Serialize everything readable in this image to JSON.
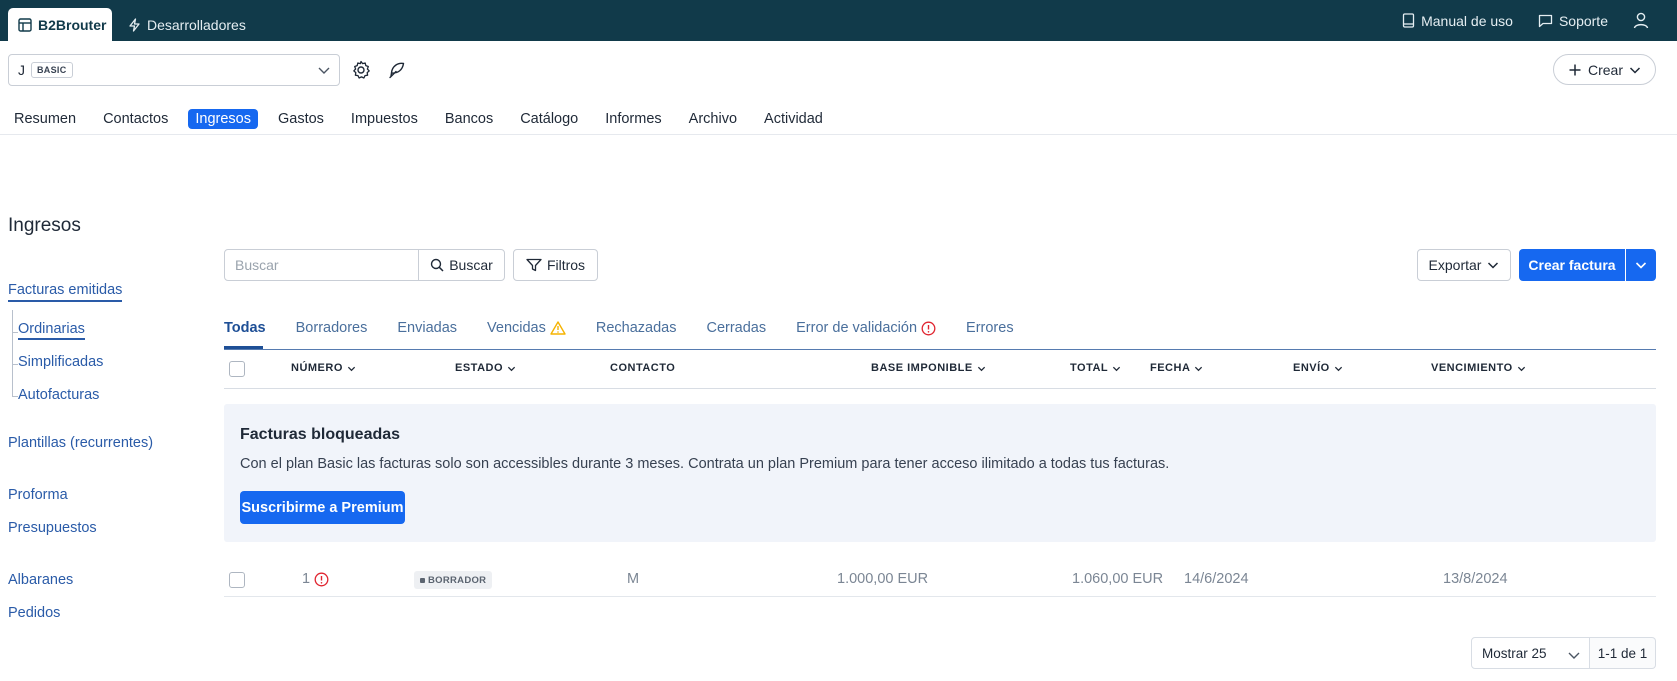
{
  "topbar": {
    "app_tab": "B2Brouter",
    "dev_tab": "Desarrolladores",
    "manual": "Manual de uso",
    "support": "Soporte",
    "icons": {
      "app": "table-icon",
      "dev": "bolt-icon",
      "manual": "book-icon",
      "support": "chat-icon",
      "user": "user-icon"
    }
  },
  "company": {
    "initial": "J",
    "plan": "BASIC",
    "create_label": "Crear"
  },
  "nav": {
    "items": [
      "Resumen",
      "Contactos",
      "Ingresos",
      "Gastos",
      "Impuestos",
      "Bancos",
      "Catálogo",
      "Informes",
      "Archivo",
      "Actividad"
    ],
    "active": "Ingresos"
  },
  "sidebar": {
    "title": "Ingresos",
    "issued": "Facturas emitidas",
    "sub": [
      "Ordinarias",
      "Simplificadas",
      "Autofacturas"
    ],
    "templates": "Plantillas (recurrentes)",
    "proforma": "Proforma",
    "quotes": "Presupuestos",
    "delivery": "Albaranes",
    "orders": "Pedidos"
  },
  "toolbar": {
    "search_placeholder": "Buscar",
    "search_label": "Buscar",
    "filter_label": "Filtros",
    "export_label": "Exportar",
    "create_label": "Crear factura"
  },
  "status_tabs": [
    "Todas",
    "Borradores",
    "Enviadas",
    "Vencidas",
    "Rechazadas",
    "Cerradas",
    "Error de validación",
    "Errores"
  ],
  "table": {
    "headers": {
      "number": "NÚMERO",
      "status": "ESTADO",
      "contact": "CONTACTO",
      "base": "BASE IMPONIBLE",
      "total": "TOTAL",
      "date": "FECHA",
      "send": "ENVÍO",
      "due": "VENCIMIENTO"
    },
    "rows": [
      {
        "number": "1",
        "status": "BORRADOR",
        "contact": "M",
        "base": "1.000,00 EUR",
        "total": "1.060,00 EUR",
        "date": "14/6/2024",
        "send": "",
        "due": "13/8/2024"
      }
    ]
  },
  "banner": {
    "title": "Facturas bloqueadas",
    "text": "Con el plan Basic las facturas solo son accessibles durante 3 meses. Contrata un plan Premium para tener acceso ilimitado a todas tus facturas.",
    "button": "Suscribirme a Premium"
  },
  "pagination": {
    "page_size": "Mostrar 25",
    "info": "1-1 de 1"
  },
  "colors": {
    "topbar": "#113a4a",
    "accent": "#1668f0",
    "link": "#2a5ba8",
    "warning": "#f5b301",
    "error": "#e0242f"
  }
}
